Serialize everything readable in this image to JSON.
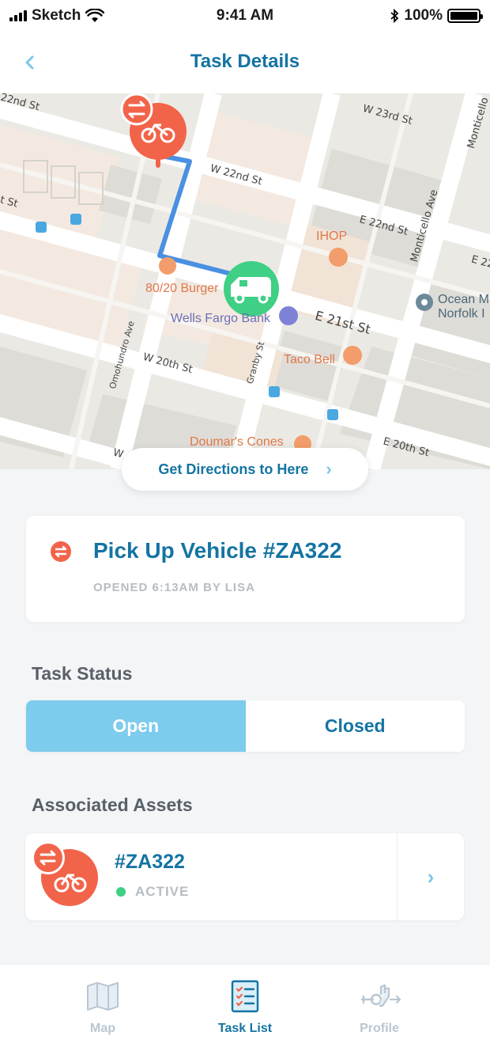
{
  "status_bar": {
    "carrier": "Sketch",
    "time": "9:41 AM",
    "battery": "100%"
  },
  "nav": {
    "title": "Task Details",
    "back_icon": "chevron-left-icon"
  },
  "map": {
    "streets": [
      "22nd St",
      "W 23rd St",
      "Monticello",
      "W 22nd St",
      "t St",
      "E 22nd St",
      "Monticello Ave",
      "E 22",
      "E 21st St",
      "Omohundro Ave",
      "W 20th St",
      "Granby St",
      "E 20th St",
      "W"
    ],
    "pois": {
      "ihop": "IHOP",
      "burger": "80/20 Burger",
      "bank": "Wells Fargo Bank",
      "taco": "Taco Bell",
      "cones": "Doumar's Cones",
      "place_line1": "Ocean M",
      "place_line2": "Norfolk I"
    },
    "route_color": "#4a90e2",
    "start_pin_color": "#f2644a",
    "vehicle_pin_color": "#3fcf85"
  },
  "directions": {
    "label": "Get Directions to Here",
    "chevron": "›"
  },
  "task": {
    "title": "Pick Up Vehicle #ZA322",
    "subtitle": "OPENED 6:13AM BY LISA"
  },
  "task_status": {
    "heading": "Task Status",
    "options": [
      "Open",
      "Closed"
    ],
    "selected": "Open"
  },
  "assets": {
    "heading": "Associated Assets",
    "items": [
      {
        "id": "#ZA322",
        "status": "ACTIVE",
        "chevron": "›"
      }
    ]
  },
  "tabs": [
    {
      "label": "Map",
      "icon": "map-icon",
      "active": false
    },
    {
      "label": "Task List",
      "icon": "task-list-icon",
      "active": true
    },
    {
      "label": "Profile",
      "icon": "profile-icon",
      "active": false
    }
  ],
  "colors": {
    "accent": "#1474a3",
    "light_accent": "#7dcbed",
    "danger": "#f2644a",
    "success": "#3fcf85"
  }
}
